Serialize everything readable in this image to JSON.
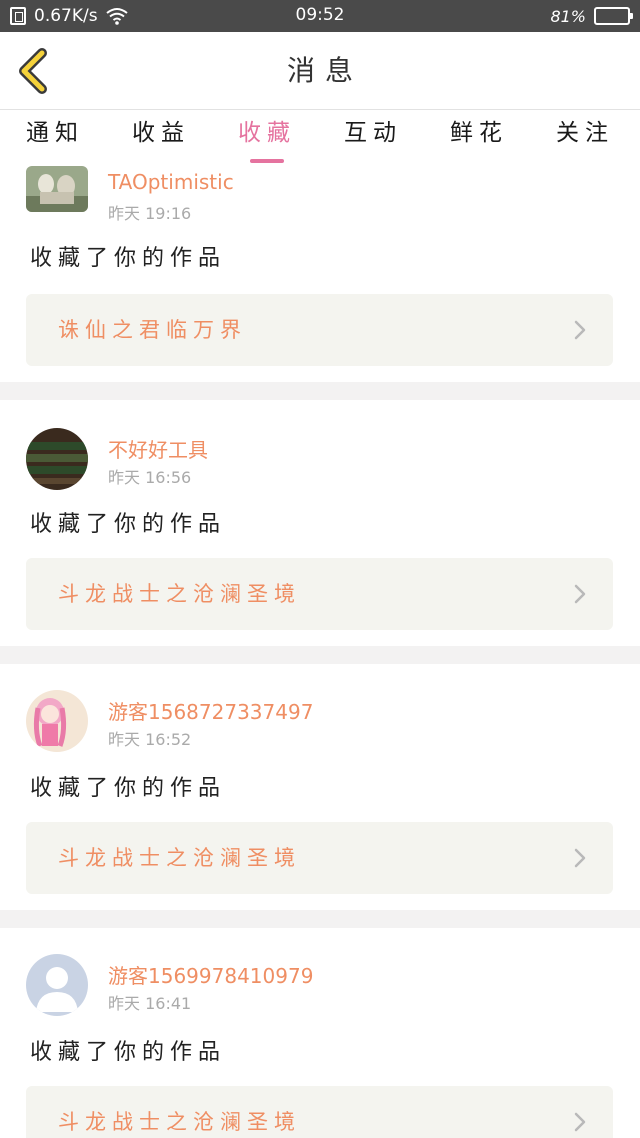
{
  "status_bar": {
    "network_speed": "0.67K/s",
    "time": "09:52",
    "battery": "81%",
    "battery_level": 0.81,
    "icons": [
      "sim-icon",
      "wifi-icon",
      "battery-icon"
    ]
  },
  "header": {
    "title": "消息",
    "back_icon": "chevron-left-icon"
  },
  "tabs": [
    {
      "label": "通知",
      "active": false
    },
    {
      "label": "收益",
      "active": false
    },
    {
      "label": "收藏",
      "active": true
    },
    {
      "label": "互动",
      "active": false
    },
    {
      "label": "鲜花",
      "active": false
    },
    {
      "label": "关注",
      "active": false
    }
  ],
  "notifications": [
    {
      "username": "TAOptimistic",
      "time": "昨天 19:16",
      "action": "收藏了你的作品",
      "work_title": "诛仙之君临万界",
      "avatar": "photo"
    },
    {
      "username": "不好好工具",
      "time": "昨天 16:56",
      "action": "收藏了你的作品",
      "work_title": "斗龙战士之沧澜圣境",
      "avatar": "photo"
    },
    {
      "username": "游客1568727337497",
      "time": "昨天 16:52",
      "action": "收藏了你的作品",
      "work_title": "斗龙战士之沧澜圣境",
      "avatar": "photo"
    },
    {
      "username": "游客1569978410979",
      "time": "昨天 16:41",
      "action": "收藏了你的作品",
      "work_title": "斗龙战士之沧澜圣境",
      "avatar": "default-user-icon"
    }
  ],
  "colors": {
    "accent": "#e5739f",
    "name": "#ef8e63",
    "status_bar": "#4a4a4a",
    "card_box": "#f4f4ef"
  }
}
